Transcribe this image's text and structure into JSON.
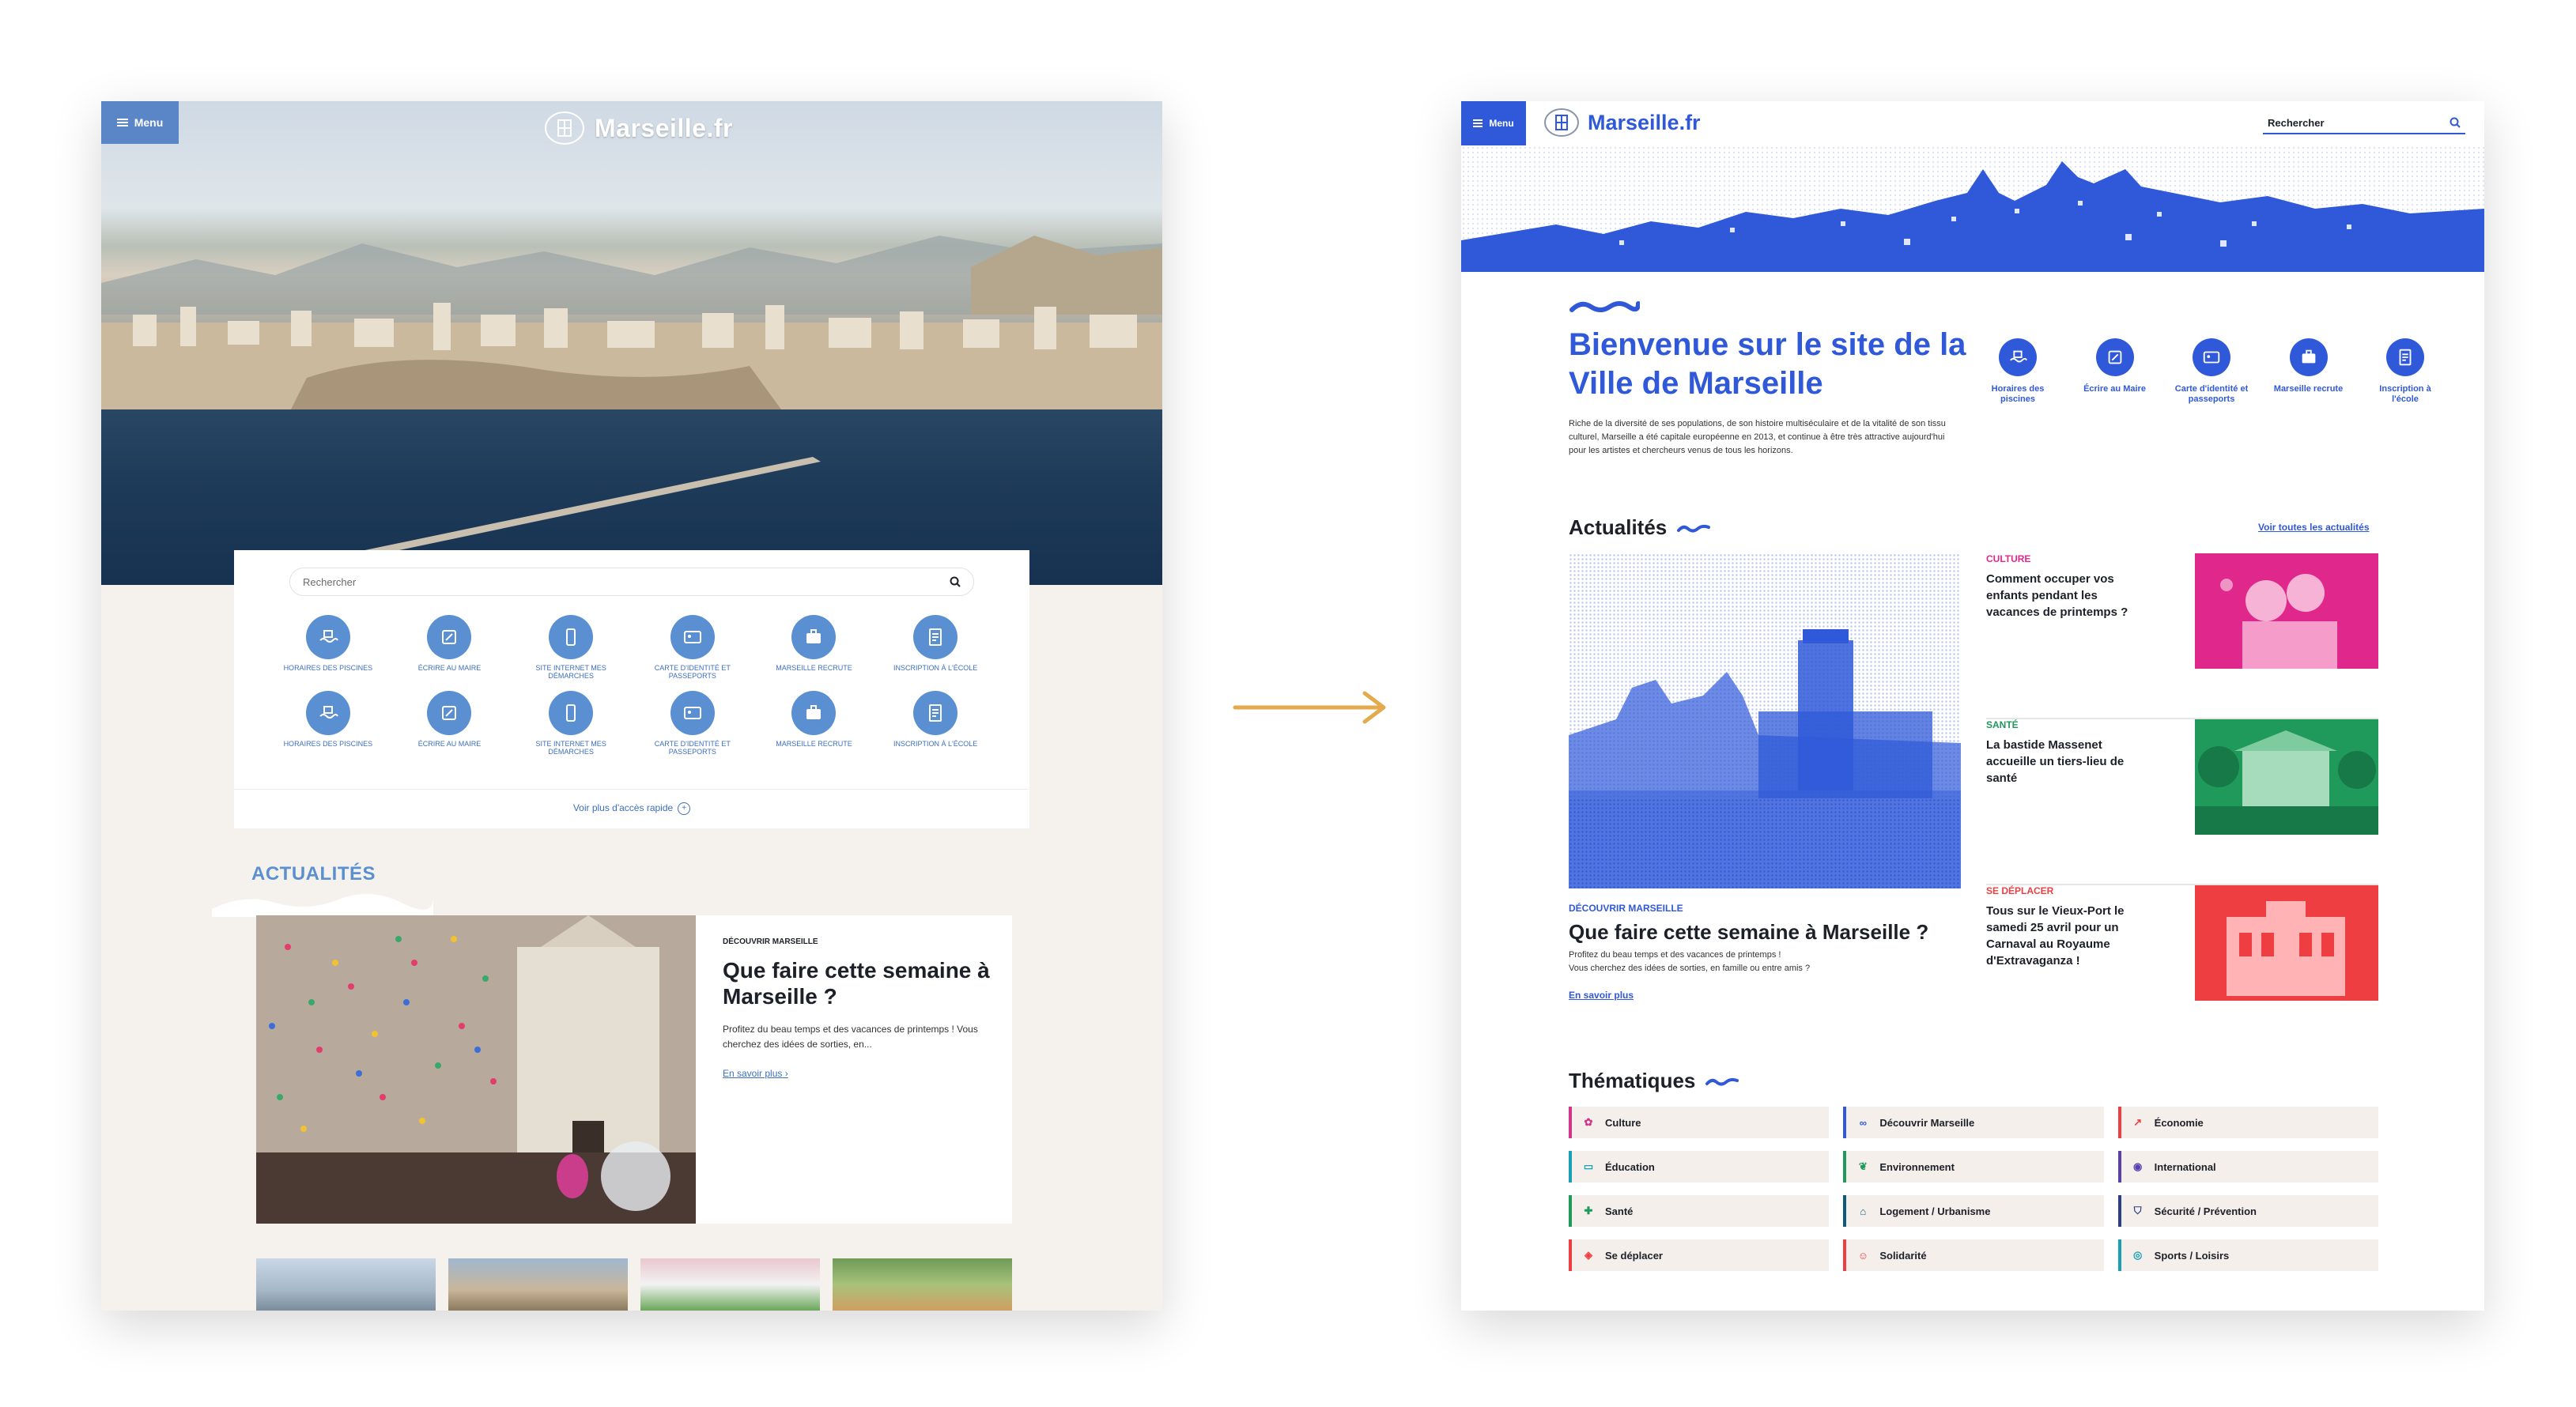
{
  "left_mockup": {
    "menu_label": "Menu",
    "logo_text": "Marseille.fr",
    "search_placeholder": "Rechercher",
    "quick_access": [
      {
        "label": "Horaires des piscines",
        "icon": "pool-icon"
      },
      {
        "label": "Écrire au maire",
        "icon": "write-icon"
      },
      {
        "label": "Site internet mes démarches",
        "icon": "phone-icon"
      },
      {
        "label": "Carte d'identité et passeports",
        "icon": "id-card-icon"
      },
      {
        "label": "Marseille recrute",
        "icon": "briefcase-icon"
      },
      {
        "label": "Inscription à l'école",
        "icon": "form-icon"
      },
      {
        "label": "Horaires des piscines",
        "icon": "pool-icon"
      },
      {
        "label": "Écrire au maire",
        "icon": "write-icon"
      },
      {
        "label": "Site internet mes démarches",
        "icon": "phone-icon"
      },
      {
        "label": "Carte d'identité et passeports",
        "icon": "id-card-icon"
      },
      {
        "label": "Marseille recrute",
        "icon": "briefcase-icon"
      },
      {
        "label": "Inscription à l'école",
        "icon": "form-icon"
      }
    ],
    "more_link": "Voir plus d'accès rapide",
    "news_title": "ACTUALITÉS",
    "featured": {
      "kicker": "Découvrir Marseille",
      "title": "Que faire cette semaine à Marseille ?",
      "description": "Profitez du beau temps et des vacances de printemps ! Vous cherchez des idées de sorties, en...",
      "link": "En savoir plus"
    }
  },
  "right_mockup": {
    "menu_label": "Menu",
    "logo_text": "Marseille.fr",
    "search_label": "Rechercher",
    "title": "Bienvenue sur le site de la Ville de Marseille",
    "intro": "Riche de la diversité de ses populations, de son histoire multiséculaire et de la vitalité de son tissu culturel, Marseille a été capitale européenne en 2013, et continue à être très attractive aujourd'hui pour les artistes et chercheurs venus de tous les horizons.",
    "quick_access": [
      {
        "label": "Horaires des piscines",
        "icon": "pool-icon"
      },
      {
        "label": "Écrire au Maire",
        "icon": "write-icon"
      },
      {
        "label": "Carte d'identité et passeports",
        "icon": "id-card-icon"
      },
      {
        "label": "Marseille recrute",
        "icon": "briefcase-icon"
      },
      {
        "label": "Inscription à l'école",
        "icon": "form-icon"
      }
    ],
    "news": {
      "heading": "Actualités",
      "see_all": "Voir toutes les actualités",
      "featured": {
        "kicker": "Découvrir Marseille",
        "title": "Que faire cette semaine à Marseille ?",
        "description_1": "Profitez du beau temps et des vacances de printemps !",
        "description_2": "Vous cherchez des idées de sorties, en famille ou entre amis ?",
        "link": "En savoir plus"
      },
      "side": [
        {
          "kicker": "Culture",
          "title": "Comment occuper vos enfants pendant les vacances de printemps ?",
          "color": "#e0288c"
        },
        {
          "kicker": "Santé",
          "title": "La bastide Massenet accueille un tiers-lieu de santé",
          "color": "#1f9a5b"
        },
        {
          "kicker": "Se déplacer",
          "title": "Tous sur le Vieux-Port le samedi 25 avril pour un Carnaval au Royaume d'Extravaganza !",
          "color": "#ef3e42"
        }
      ]
    },
    "themes": {
      "heading": "Thématiques",
      "items": [
        {
          "label": "Culture",
          "color": "#d1368b",
          "icon": "culture-icon"
        },
        {
          "label": "Découvrir Marseille",
          "color": "#2f59d8",
          "icon": "binoculars-icon"
        },
        {
          "label": "Économie",
          "color": "#ef3e42",
          "icon": "chart-icon"
        },
        {
          "label": "Éducation",
          "color": "#19a0b6",
          "icon": "book-icon"
        },
        {
          "label": "Environnement",
          "color": "#1f9a5b",
          "icon": "leaf-icon"
        },
        {
          "label": "International",
          "color": "#5a3fb0",
          "icon": "globe-icon"
        },
        {
          "label": "Santé",
          "color": "#1f9a5b",
          "icon": "health-icon"
        },
        {
          "label": "Logement / Urbanisme",
          "color": "#0f5a7a",
          "icon": "house-icon"
        },
        {
          "label": "Sécurité / Prévention",
          "color": "#2c3e87",
          "icon": "shield-icon"
        },
        {
          "label": "Se déplacer",
          "color": "#ef3e42",
          "icon": "pin-icon"
        },
        {
          "label": "Solidarité",
          "color": "#ef3e42",
          "icon": "people-icon"
        },
        {
          "label": "Sports / Loisirs",
          "color": "#19a0b6",
          "icon": "ball-icon"
        }
      ]
    }
  },
  "colors": {
    "left_accent": "#5a8fd1",
    "right_accent": "#2f59d8",
    "arrow": "#e3aa4e"
  }
}
